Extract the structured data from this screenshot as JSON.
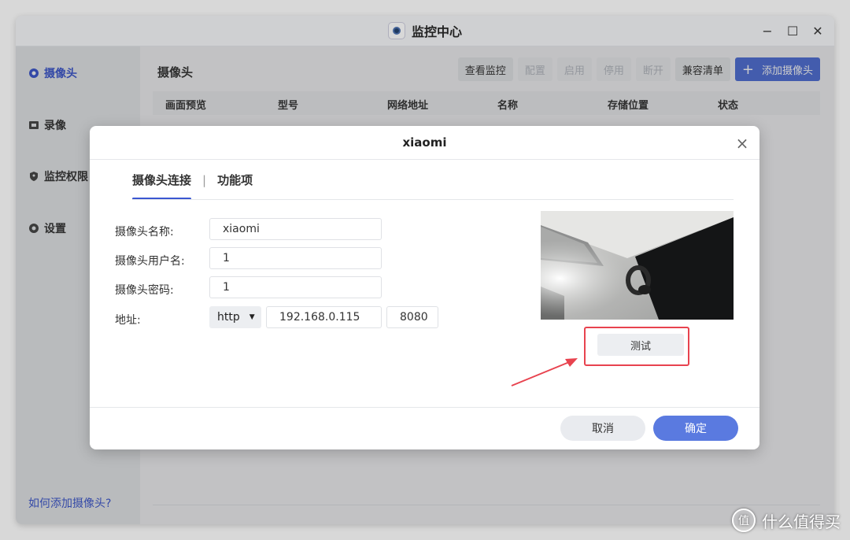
{
  "app": {
    "title": "监控中心",
    "controls": [
      "−",
      "☐",
      "✕"
    ]
  },
  "sidebar": {
    "items": [
      {
        "label": "摄像头",
        "icon": "camera-icon"
      },
      {
        "label": "录像",
        "icon": "film-icon"
      },
      {
        "label": "监控权限",
        "icon": "shield-icon"
      },
      {
        "label": "设置",
        "icon": "gear-icon"
      }
    ],
    "help_link": "如何添加摄像头?"
  },
  "main": {
    "title": "摄像头",
    "toolbar": {
      "view": "查看监控",
      "config": "配置",
      "enable": "启用",
      "disable": "停用",
      "disconnect": "断开",
      "compat": "兼容清单",
      "add": "添加摄像头",
      "add_icon": "+"
    },
    "columns": [
      "画面预览",
      "型号",
      "网络地址",
      "名称",
      "存储位置",
      "状态"
    ]
  },
  "dialog": {
    "title": "xiaomi",
    "close_icon": "×",
    "tabs": [
      "摄像头连接",
      "功能项"
    ],
    "tab_divider": "|",
    "form": {
      "name_label": "摄像头名称:",
      "name_value": "xiaomi",
      "user_label": "摄像头用户名:",
      "user_value": "1",
      "password_label": "摄像头密码:",
      "password_value": "1",
      "address_label": "地址:",
      "protocol": "http",
      "caret": "▼",
      "ip": "192.168.0.115",
      "port": "8080"
    },
    "test_button": "测试",
    "cancel_button": "取消",
    "ok_button": "确定"
  },
  "watermark": {
    "text": "什么值得买",
    "logo": "值"
  },
  "colors": {
    "accent": "#3b57d1",
    "primary_button": "#5a7ae0",
    "highlight": "#e8434f"
  }
}
